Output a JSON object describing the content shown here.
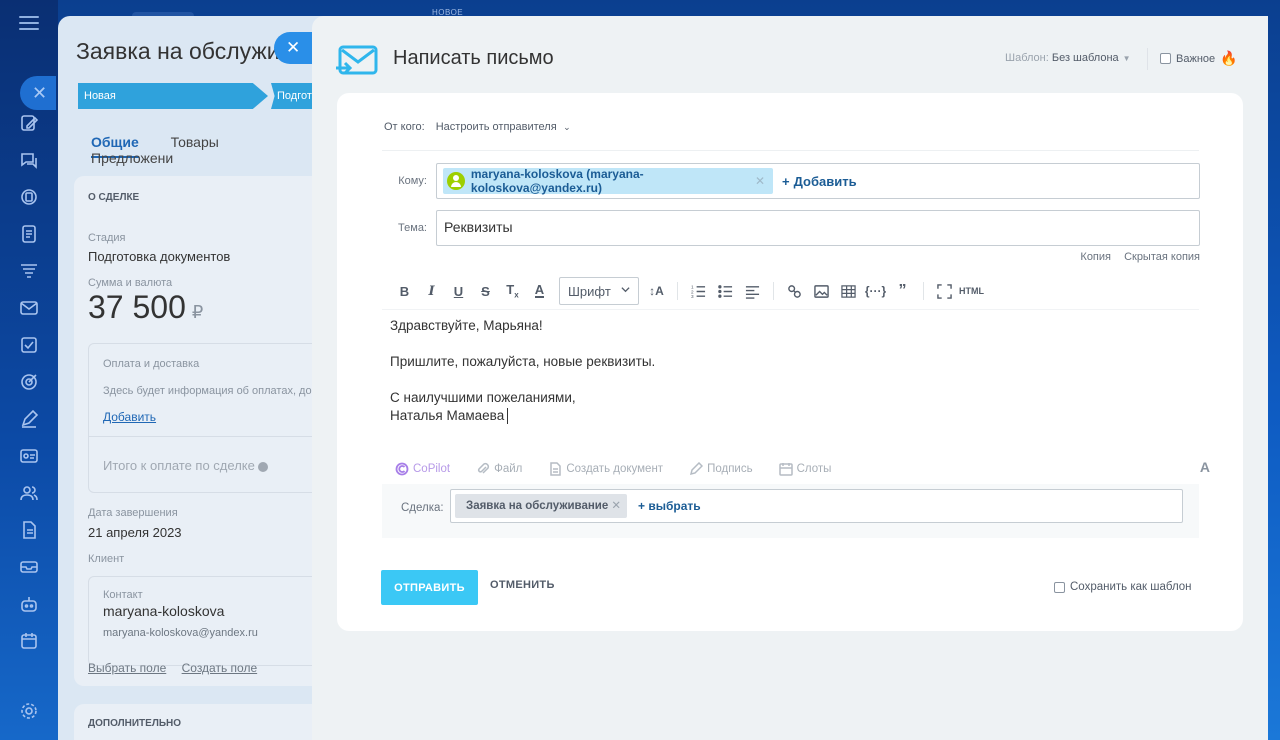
{
  "background_deal": {
    "title": "Заявка на обслужив",
    "stages": [
      "Новая",
      "Подгот"
    ],
    "tabs": [
      "Общие",
      "Товары",
      "Предложени"
    ],
    "section_about": "О СДЕЛКЕ",
    "stage_label": "Стадия",
    "stage_value": "Подготовка документов",
    "amount_label": "Сумма и валюта",
    "amount_value": "37 500",
    "currency": "₽",
    "payment_title": "Оплата и доставка",
    "payment_text": "Здесь будет информация об оплатах, до",
    "payment_add": "Добавить",
    "total_label": "Итого к оплате по сделке",
    "close_date_label": "Дата завершения",
    "close_date_value": "21 апреля 2023",
    "client_label": "Клиент",
    "contact_label": "Контакт",
    "contact_name": "maryana-koloskova",
    "contact_email": "maryana-koloskova@yandex.ru",
    "link_choose_field": "Выбрать поле",
    "link_create_field": "Создать поле",
    "section_additional": "ДОПОЛНИТЕЛЬНО",
    "top_label": "НОВОЕ"
  },
  "compose": {
    "title": "Написать письмо",
    "template_label": "Шаблон:",
    "template_value": "Без шаблона",
    "important_label": "Важное",
    "from_label": "От кого:",
    "from_value": "Настроить отправителя",
    "to_label": "Кому:",
    "to_recipient": "maryana-koloskova (maryana-koloskova@yandex.ru)",
    "to_add": "Добавить",
    "subject_label": "Тема:",
    "subject_value": "Реквизиты",
    "cc_label": "Копия",
    "bcc_label": "Скрытая копия",
    "font_select": "Шрифт",
    "html_label": "HTML",
    "body": {
      "line1": "Здравствуйте, Марьяна!",
      "line2": "Пришлите, пожалуйста, новые реквизиты.",
      "line3": "С наилучшими пожеланиями,",
      "line4": "Наталья Мамаева"
    },
    "attachments": {
      "copilot": "CoPilot",
      "file": "Файл",
      "create_doc": "Создать документ",
      "signature": "Подпись",
      "slots": "Слоты"
    },
    "deal_label": "Сделка:",
    "deal_value": "Заявка на обслуживание",
    "deal_choose": "выбрать",
    "send_button": "ОТПРАВИТЬ",
    "cancel_button": "ОТМЕНИТЬ",
    "save_template": "Сохранить как шаблон"
  },
  "colors": {
    "accent": "#3bc8f5",
    "link": "#1b5c95",
    "chip": "#bfe6f8",
    "stage": "#2fa2dc"
  }
}
